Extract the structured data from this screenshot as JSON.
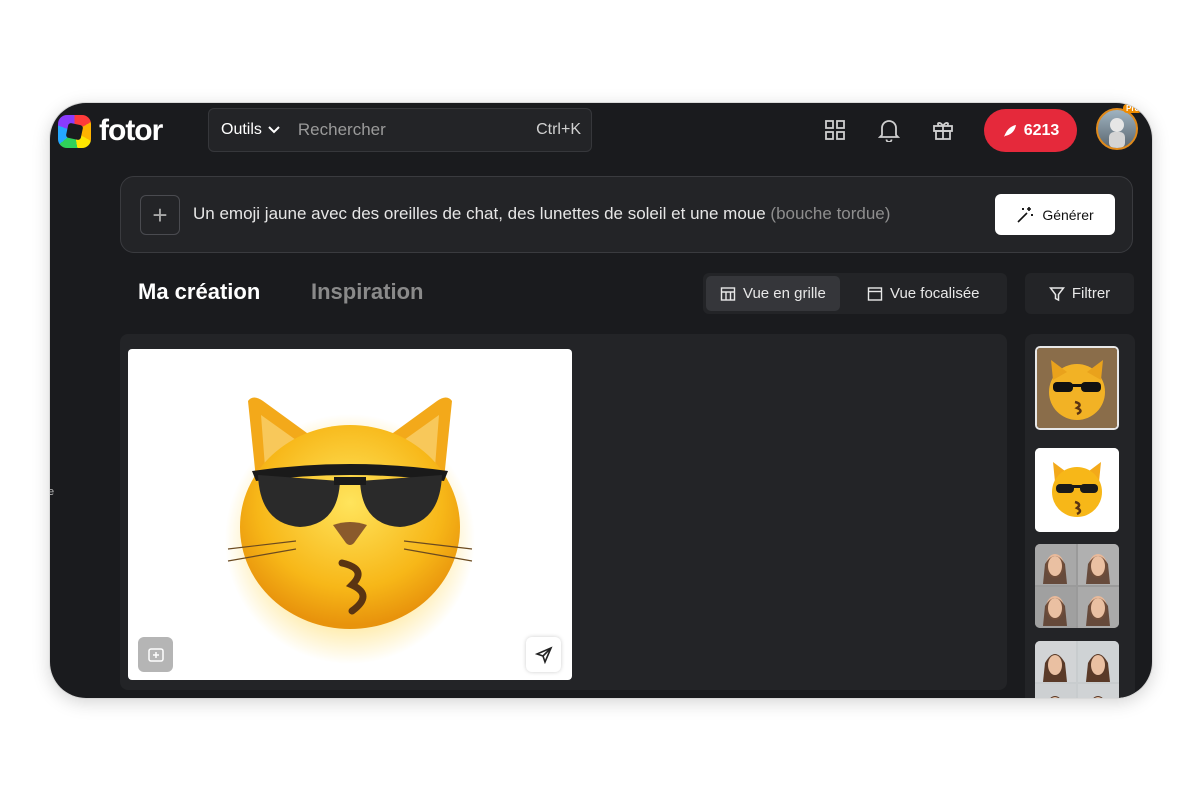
{
  "header": {
    "logo_text": "fotor",
    "search": {
      "tools_label": "Outils",
      "placeholder": "Rechercher",
      "shortcut": "Ctrl+K"
    },
    "icons": [
      "apps-grid-icon",
      "bell-icon",
      "gift-icon"
    ],
    "credits": "6213",
    "avatar_badge": "Pro"
  },
  "prompt": {
    "text_main": "Un emoji jaune avec des oreilles de chat, des lunettes de soleil et une moue ",
    "text_faded": "(bouche tordue)",
    "generate_label": "Générer"
  },
  "tabs": {
    "active": "Ma création",
    "inactive": "Inspiration"
  },
  "views": {
    "grid_label": "Vue en grille",
    "focused_label": "Vue focalisée",
    "active": "grid"
  },
  "filter_label": "Filtrer",
  "side_glyph": "e",
  "colors": {
    "accent_red": "#e5293b",
    "background": "#1a1b1e",
    "panel": "#232427",
    "avatar_ring": "#e08a1b"
  }
}
